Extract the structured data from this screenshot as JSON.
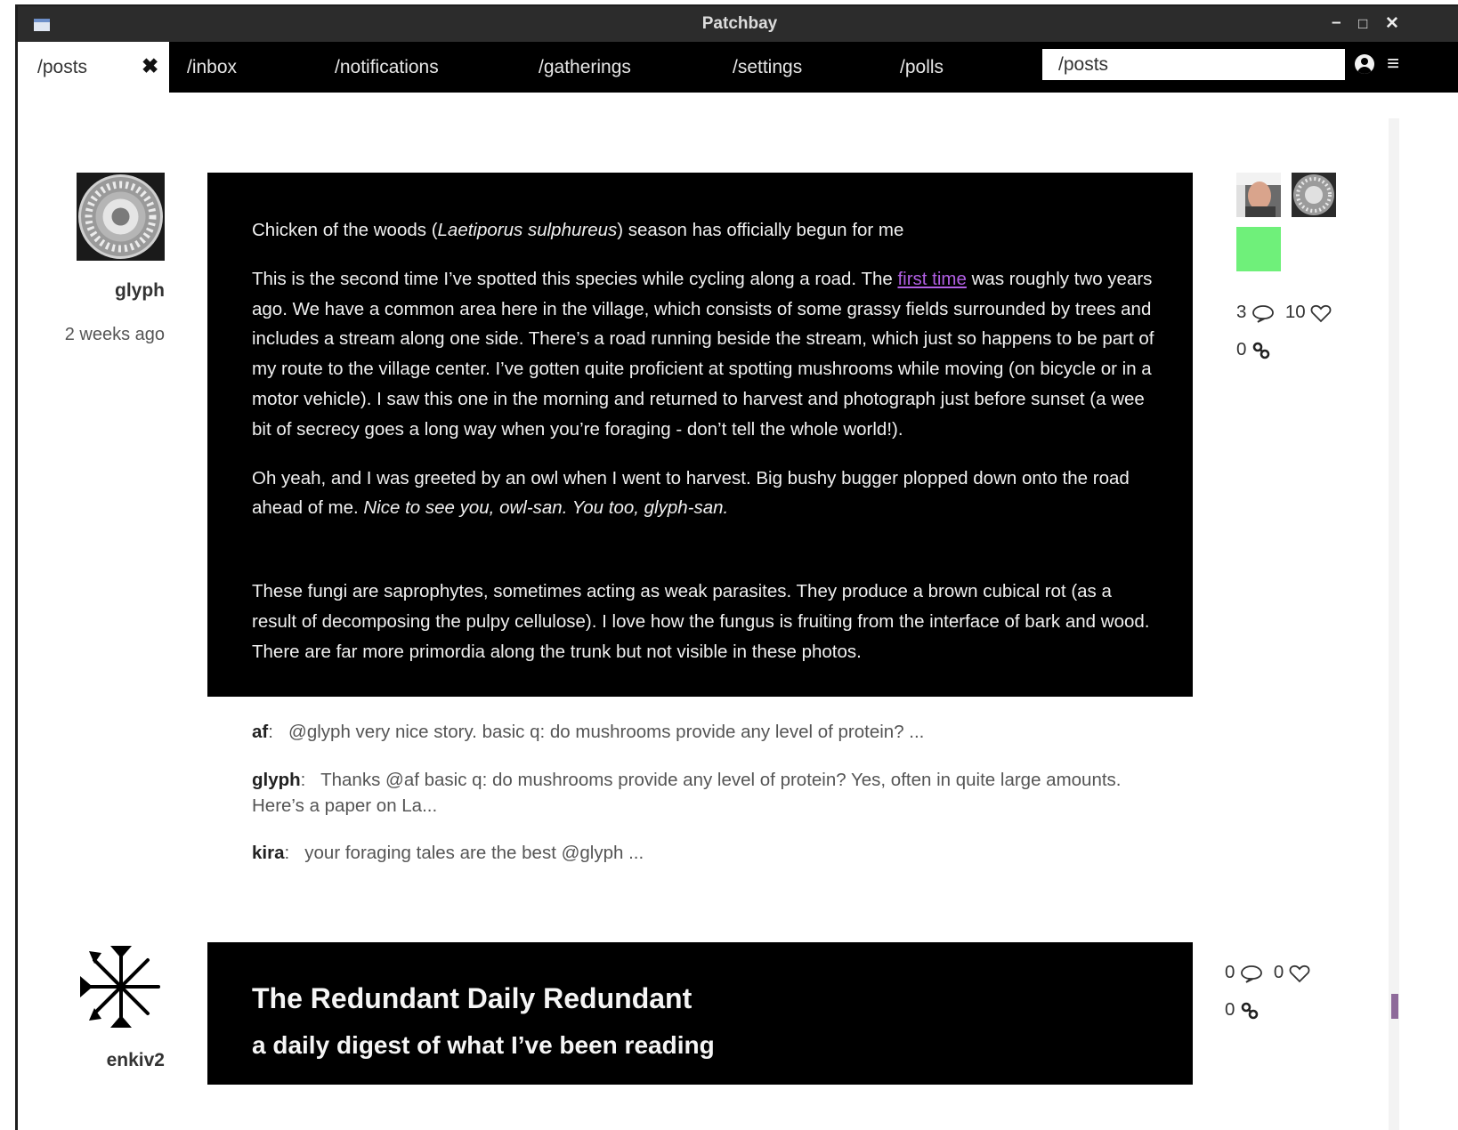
{
  "window": {
    "title": "Patchbay",
    "minimize": "–",
    "maximize": "□",
    "close": "✕"
  },
  "tabs": {
    "active": {
      "label": "/posts",
      "close_icon": "✖"
    },
    "items": [
      "/inbox",
      "/notifications",
      "/gatherings",
      "/settings",
      "/polls"
    ],
    "address_value": "/posts",
    "menu_icon": "≡"
  },
  "colors": {
    "link": "#b15fe3",
    "accent_square": "#6ff07a",
    "scroll_thumb": "#8e6a9a"
  },
  "posts": [
    {
      "author": "glyph",
      "timestamp": "2 weeks ago",
      "p1_a": "Chicken of the woods (",
      "p1_i": "Laetiporus sulphureus",
      "p1_b": ") season has officially begun for me",
      "p2_a": "This is the second time I’ve spotted this species while cycling along a road. The ",
      "p2_link": "first time",
      "p2_b": " was roughly two years ago. We have a common area here in the village, which consists of some grassy fields surrounded by trees and includes a stream along one side. There’s a road running beside the stream, which just so happens to be part of my route to the village center. I’ve gotten quite proficient at spotting mushrooms while moving (on bicycle or in a motor vehicle). I saw this one in the morning and returned to harvest and photograph just before sunset (a wee bit of secrecy goes a long way when you’re foraging - don’t tell the whole world!).",
      "p3_a": "Oh yeah, and I was greeted by an owl when I went to harvest. Big bushy bugger plopped down onto the road ahead of me. ",
      "p3_i": "Nice to see you, owl-san. You too, glyph-san.",
      "p4": "These fungi are saprophytes, sometimes acting as weak parasites. They produce a brown cubical rot (as a result of decomposing the pulpy cellulose). I love how the fungus is fruiting from the interface of bark and wood. There are far more primordia along the trunk but not visible in these photos.",
      "replies_count": "3",
      "likes_count": "10",
      "backlinks_count": "0",
      "replies": [
        {
          "author": "af",
          "text": "@glyph very nice story. basic q: do mushrooms provide any level of protein? ..."
        },
        {
          "author": "glyph",
          "text": "Thanks @af basic q: do mushrooms provide any level of protein? Yes, often in quite large amounts. Here’s a paper on La..."
        },
        {
          "author": "kira",
          "text": "your foraging tales are the best @glyph ..."
        }
      ]
    },
    {
      "author": "enkiv2",
      "title": "The Redundant Daily Redundant",
      "subtitle": "a daily digest of what I’ve been reading",
      "replies_count": "0",
      "likes_count": "0",
      "backlinks_count": "0"
    }
  ]
}
